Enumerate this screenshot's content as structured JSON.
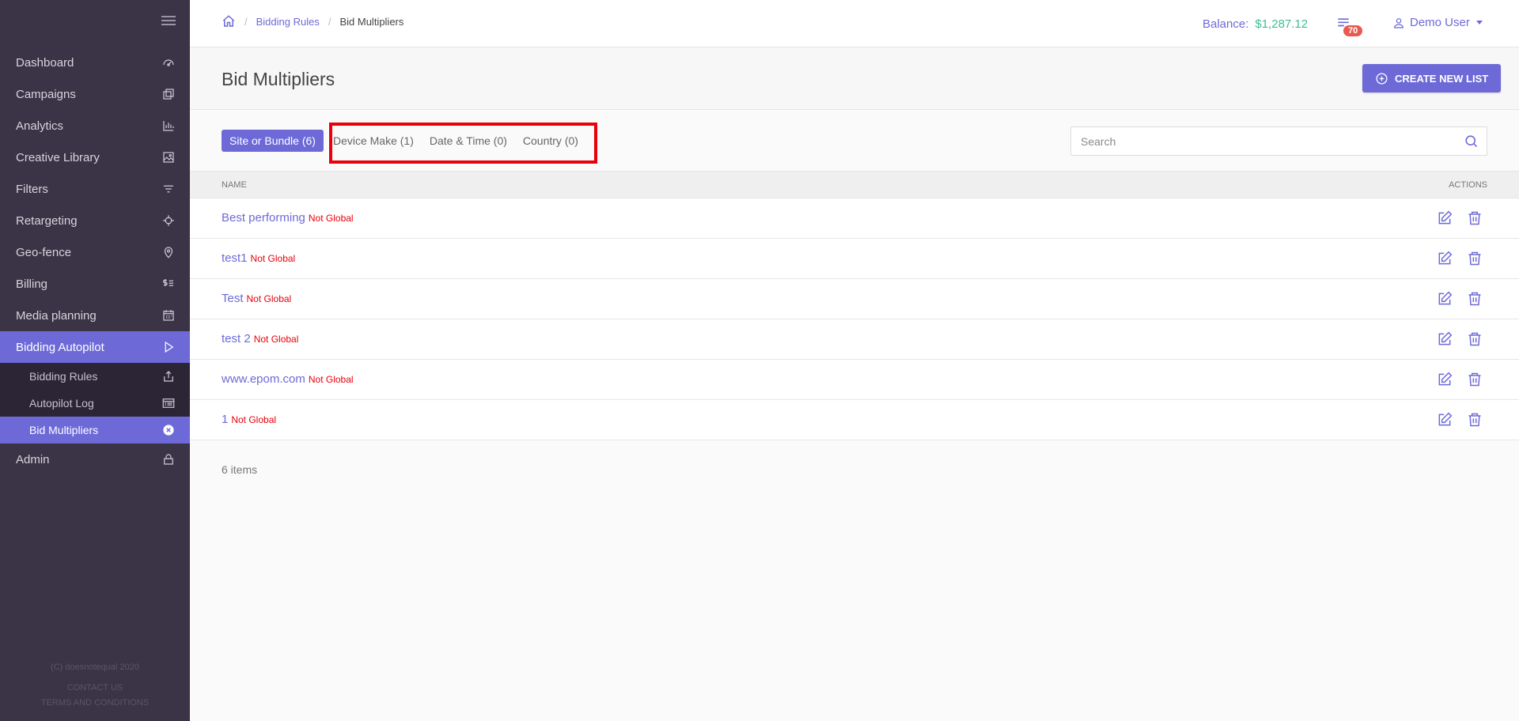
{
  "sidebar": {
    "items": [
      {
        "label": "Dashboard",
        "icon": "gauge-icon"
      },
      {
        "label": "Campaigns",
        "icon": "copy-icon"
      },
      {
        "label": "Analytics",
        "icon": "bar-chart-icon"
      },
      {
        "label": "Creative Library",
        "icon": "image-icon"
      },
      {
        "label": "Filters",
        "icon": "filter-icon"
      },
      {
        "label": "Retargeting",
        "icon": "crosshair-icon"
      },
      {
        "label": "Geo-fence",
        "icon": "map-pin-icon"
      },
      {
        "label": "Billing",
        "icon": "dollar-list-icon"
      },
      {
        "label": "Media planning",
        "icon": "calendar-icon"
      },
      {
        "label": "Bidding Autopilot",
        "icon": "play-icon"
      }
    ],
    "sub_items": [
      {
        "label": "Bidding Rules",
        "icon": "upload-icon"
      },
      {
        "label": "Autopilot Log",
        "icon": "log-list-icon"
      },
      {
        "label": "Bid Multipliers",
        "icon": "close-circle-icon"
      }
    ],
    "admin": {
      "label": "Admin",
      "icon": "lock-icon"
    },
    "footer": {
      "copyright": "(C) doesnotequal 2020",
      "contact": "CONTACT US",
      "terms": "TERMS AND CONDITIONS"
    }
  },
  "header": {
    "breadcrumb": {
      "parent": "Bidding Rules",
      "current": "Bid Multipliers"
    },
    "balance_label": "Balance:",
    "balance_amount": "$1,287.12",
    "notifications_count": "70",
    "user_name": "Demo User"
  },
  "page": {
    "title": "Bid Multipliers",
    "create_button": "CREATE NEW LIST"
  },
  "tabs": [
    {
      "label": "Site or Bundle (6)",
      "active": true
    },
    {
      "label": "Device Make (1)",
      "active": false
    },
    {
      "label": "Date & Time (0)",
      "active": false
    },
    {
      "label": "Country (0)",
      "active": false
    }
  ],
  "search": {
    "placeholder": "Search",
    "value": ""
  },
  "table": {
    "columns": {
      "name": "NAME",
      "actions": "ACTIONS"
    },
    "rows": [
      {
        "name": "Best performing",
        "scope": "Not Global"
      },
      {
        "name": "test1",
        "scope": "Not Global"
      },
      {
        "name": "Test",
        "scope": "Not Global"
      },
      {
        "name": "test 2",
        "scope": "Not Global"
      },
      {
        "name": "www.epom.com",
        "scope": "Not Global"
      },
      {
        "name": "1",
        "scope": "Not Global"
      }
    ]
  },
  "items_count": "6 items",
  "colors": {
    "accent": "#6d6ad8",
    "sidebar_bg": "#3a3446",
    "balance_green": "#3dbe8c",
    "alert_red": "#e8000a",
    "badge_red": "#e85a4f"
  }
}
